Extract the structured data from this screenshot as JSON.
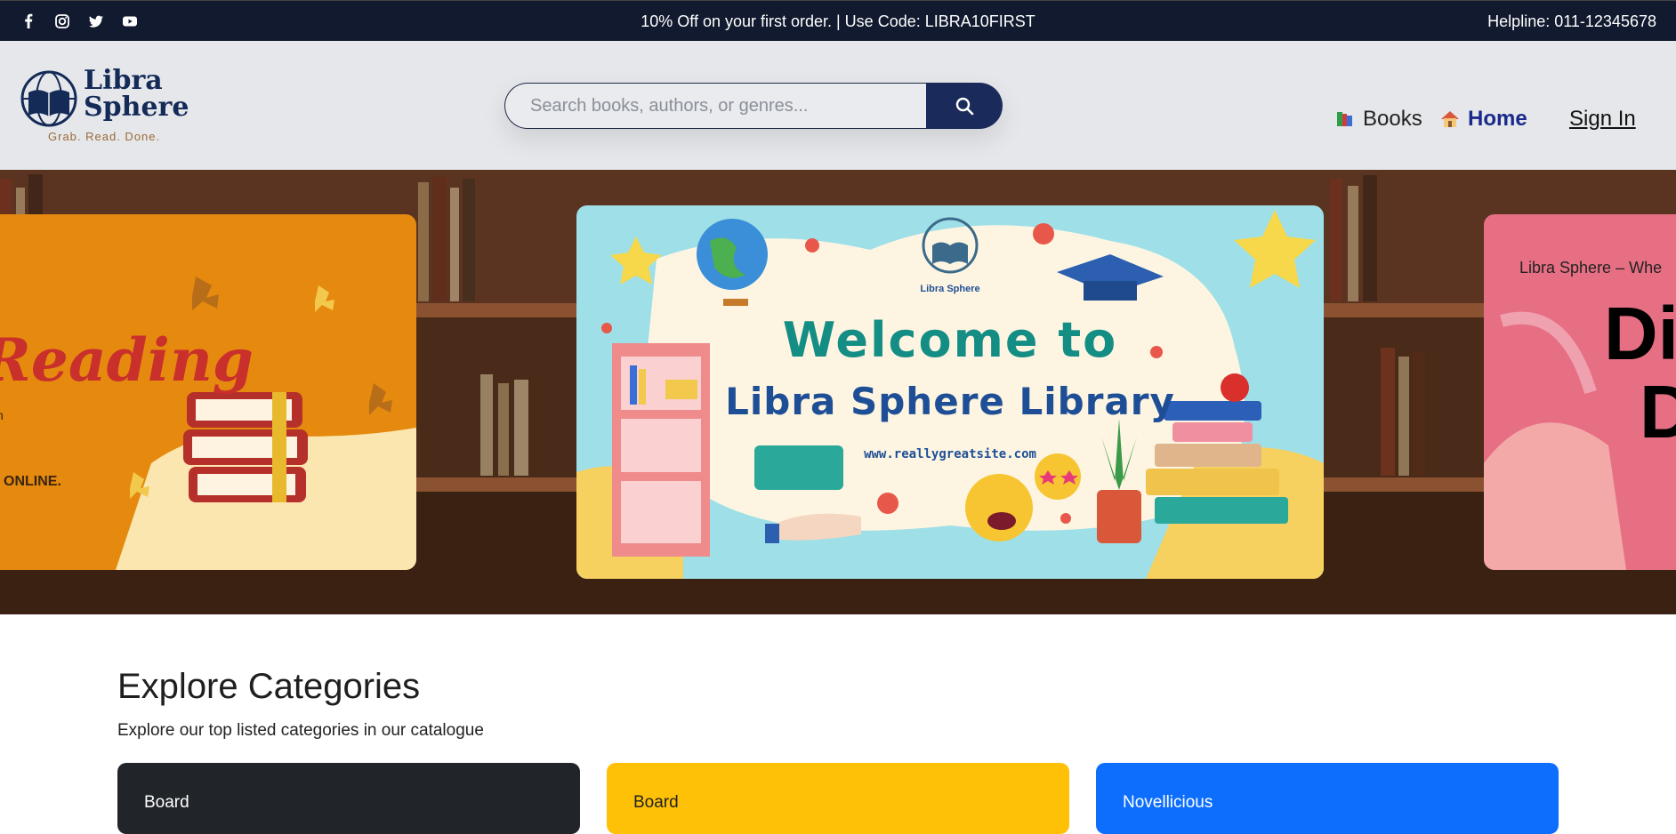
{
  "topbar": {
    "social": [
      "facebook-icon",
      "instagram-icon",
      "twitter-icon",
      "youtube-icon"
    ],
    "promo": "10% Off on your first order. | Use Code: LIBRA10FIRST",
    "helpline": "Helpline: 011-12345678"
  },
  "header": {
    "logo": {
      "name_line1": "Libra",
      "name_line2": "Sphere",
      "tagline": "Grab. Read. Done."
    },
    "search": {
      "placeholder": "Search books, authors, or genres..."
    },
    "nav": {
      "books": "Books",
      "home": "Home",
      "sign_in": "Sign In"
    }
  },
  "hero": {
    "left_slide": {
      "title": "Reading",
      "text_fragment": "h",
      "online": "ONLINE."
    },
    "center_slide": {
      "logo_label": "Libra Sphere",
      "title": "Welcome to",
      "subtitle": "Libra Sphere Library",
      "url": "www.reallygreatsite.com"
    },
    "right_slide": {
      "caption": "Libra Sphere – Whe",
      "big_line1": "Dis",
      "big_line2": "D"
    }
  },
  "categories": {
    "title": "Explore Categories",
    "subtitle": "Explore our top listed categories in our catalogue",
    "cards": [
      {
        "label": "Board"
      },
      {
        "label": "Board"
      },
      {
        "label": "Novellicious"
      }
    ]
  },
  "colors": {
    "topbar_bg": "#111a2e",
    "header_bg": "#e5e7eb",
    "search_button": "#1a2a5a",
    "home_link": "#1a2a8a",
    "card_dark": "#212529",
    "card_yellow": "#ffc107",
    "card_blue": "#0d6efd"
  }
}
